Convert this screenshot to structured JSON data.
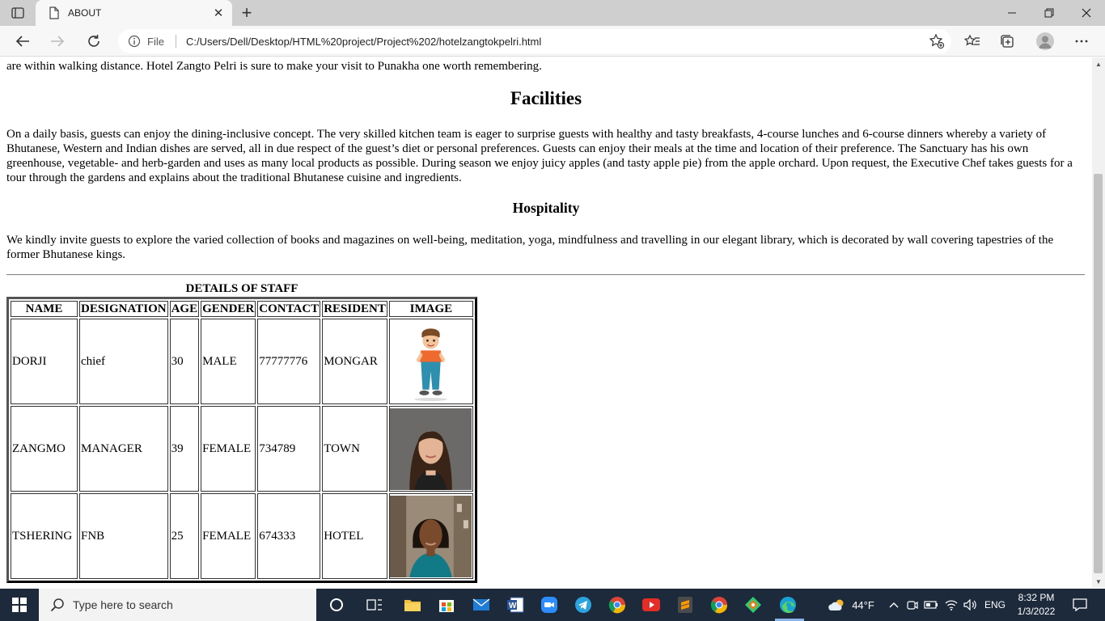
{
  "browser": {
    "tab_title": "ABOUT",
    "file_label": "File",
    "url": "C:/Users/Dell/Desktop/HTML%20project/Project%202/hotelzangtokpelri.html"
  },
  "page": {
    "intro_tail": "are within walking distance. Hotel Zangto Pelri is sure to make your visit to Punakha one worth remembering.",
    "facilities_heading": "Facilities",
    "facilities_text": "On a daily basis, guests can enjoy the dining-inclusive concept. The very skilled kitchen team is eager to surprise guests with healthy and tasty breakfasts, 4-course lunches and 6-course dinners whereby a variety of Bhutanese, Western and Indian dishes are served, all in due respect of the guest’s diet or personal preferences. Guests can enjoy their meals at the time and location of their preference. The Sanctuary has his own greenhouse, vegetable- and herb-garden and uses as many local products as possible. During season we enjoy juicy apples (and tasty apple pie) from the apple orchard. Upon request, the Executive Chef takes guests for a tour through the gardens and explains about the traditional Bhutanese cuisine and ingredients.",
    "hospitality_heading": "Hospitality",
    "hospitality_text": "We kindly invite guests to explore the varied collection of books and magazines on well-being, meditation, yoga, mindfulness and travelling in our elegant library, which is decorated by wall covering tapestries of the former Bhutanese kings.",
    "staff_table": {
      "caption": "DETAILS OF STAFF",
      "headers": [
        "NAME",
        "DESIGNATION",
        "AGE",
        "GENDER",
        "CONTACT",
        "RESIDENT",
        "IMAGE"
      ],
      "rows": [
        {
          "name": "DORJI",
          "designation": "chief",
          "age": "30",
          "gender": "MALE",
          "contact": "77777776",
          "resident": "MONGAR",
          "image": "cartoon-boy-image"
        },
        {
          "name": "ZANGMO",
          "designation": "MANAGER",
          "age": "39",
          "gender": "FEMALE",
          "contact": "734789",
          "resident": "TOWN",
          "image": "woman-portrait-image"
        },
        {
          "name": "TSHERING",
          "designation": "FNB",
          "age": "25",
          "gender": "FEMALE",
          "contact": "674333",
          "resident": "HOTEL",
          "image": "woman-street-portrait-image"
        }
      ]
    }
  },
  "taskbar": {
    "search_placeholder": "Type here to search",
    "weather": "44°F",
    "language": "ENG",
    "time": "8:32 PM",
    "date": "1/3/2022"
  },
  "colors": {
    "taskbar_bg": "#1c2a3c",
    "tabstrip_bg": "#cfcfcf",
    "toolbar_bg": "#f7f7f7"
  }
}
